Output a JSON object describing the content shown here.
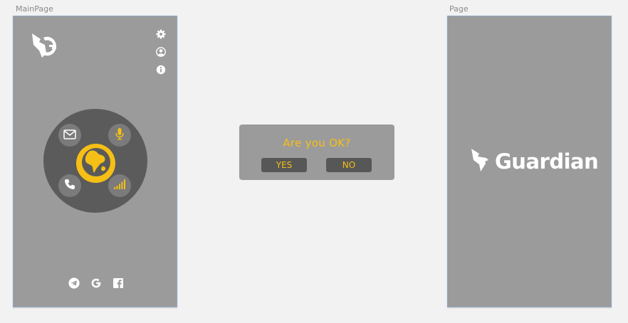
{
  "artboards": {
    "main_label": "MainPage",
    "page_label": "Page"
  },
  "main": {
    "logo_icon": "guardian-g-logo-icon",
    "side_icons": [
      "gear-icon",
      "user-icon",
      "info-icon"
    ],
    "wheel": {
      "buttons": [
        "mail-icon",
        "microphone-icon",
        "phone-icon",
        "signal-icon"
      ],
      "center": "globe-icon"
    },
    "social_icons": [
      "telegram-icon",
      "google-icon",
      "facebook-icon"
    ]
  },
  "dialog": {
    "title": "Are you OK?",
    "yes_label": "YES",
    "no_label": "NO"
  },
  "splash": {
    "brand_name": "Guardian",
    "brand_icon": "guardian-bird-icon"
  },
  "colors": {
    "accent": "#f5bf16",
    "panel": "#9b9b9b",
    "wheel": "#5b5b5b",
    "wheel_button": "#7b7b7b",
    "dialog_button": "#575757",
    "canvas": "#f2f2f2"
  }
}
